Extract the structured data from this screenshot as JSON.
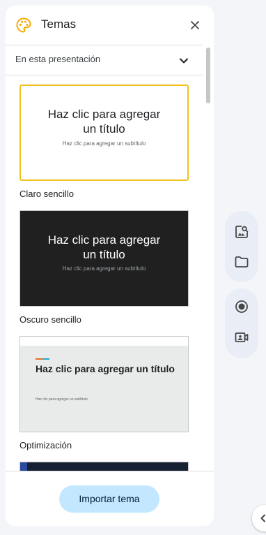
{
  "panel": {
    "title": "Temas",
    "icon": "palette-icon",
    "close_icon": "close-icon"
  },
  "dropdown": {
    "label": "En esta presentación",
    "icon": "chevron-down-icon"
  },
  "themes": [
    {
      "name": "Claro sencillo",
      "thumb_title": "Haz clic para agregar un título",
      "thumb_subtitle": "Haz clic para agregar un subtítulo",
      "selected": true
    },
    {
      "name": "Oscuro sencillo",
      "thumb_title": "Haz clic para agregar un título",
      "thumb_subtitle": "Haz clic para agregar un subtítulo",
      "selected": false
    },
    {
      "name": "Optimización",
      "thumb_title": "Haz clic para agregar un título",
      "thumb_subtitle": "Haz clic para agregar un subtítulo",
      "selected": false
    }
  ],
  "footer": {
    "import_label": "Importar tema"
  },
  "side_toolbar": {
    "icons": [
      "image-search-icon",
      "folder-icon",
      "record-icon",
      "camera-icon"
    ]
  },
  "expand_tab": {
    "icon": "chevron-left-icon"
  },
  "colors": {
    "selected_border": "#f1c21b",
    "import_button": "#c2e7ff",
    "dark_theme": "#202020"
  }
}
